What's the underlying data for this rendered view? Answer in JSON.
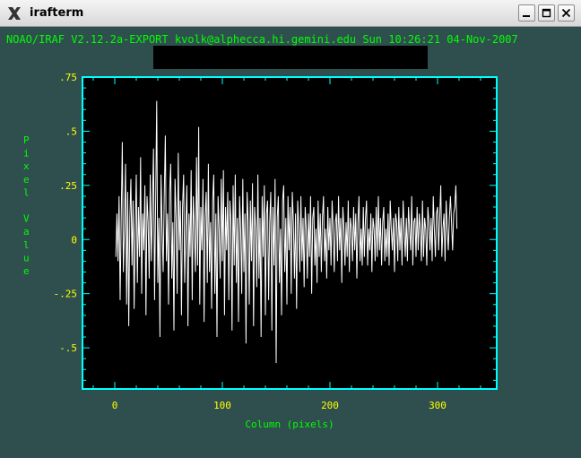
{
  "window": {
    "title": "irafterm",
    "icon": "x-logo-icon",
    "buttons": [
      "minimize",
      "maximize",
      "close"
    ]
  },
  "terminal": {
    "header": "NOAO/IRAF V2.12.2a-EXPORT kvolk@alphecca.hi.gemini.edu Sun 10:26:21 04-Nov-2007"
  },
  "colors": {
    "background": "#2f4f4f",
    "frame": "#00ffff",
    "data": "#ffffff",
    "tick_labels": "#ffff00",
    "axis_labels": "#00ff00"
  },
  "chart_data": {
    "type": "line",
    "xlabel": "Column (pixels)",
    "ylabel": "Pixel Value",
    "xlim": [
      -30,
      355
    ],
    "ylim": [
      -0.69,
      0.75
    ],
    "x_ticks": [
      "0",
      "100",
      "200",
      "300"
    ],
    "y_ticks": [
      ".75",
      ".5",
      ".25",
      "0",
      "-.25",
      "-.5"
    ],
    "x": [
      1,
      2,
      3,
      4,
      5,
      6,
      7,
      8,
      9,
      10,
      11,
      12,
      13,
      14,
      15,
      16,
      17,
      18,
      19,
      20,
      21,
      22,
      23,
      24,
      25,
      26,
      27,
      28,
      29,
      30,
      31,
      32,
      33,
      34,
      35,
      36,
      37,
      38,
      39,
      40,
      41,
      42,
      43,
      44,
      45,
      46,
      47,
      48,
      49,
      50,
      51,
      52,
      53,
      54,
      55,
      56,
      57,
      58,
      59,
      60,
      61,
      62,
      63,
      64,
      65,
      66,
      67,
      68,
      69,
      70,
      71,
      72,
      73,
      74,
      75,
      76,
      77,
      78,
      79,
      80,
      81,
      82,
      83,
      84,
      85,
      86,
      87,
      88,
      89,
      90,
      91,
      92,
      93,
      94,
      95,
      96,
      97,
      98,
      99,
      100,
      101,
      102,
      103,
      104,
      105,
      106,
      107,
      108,
      109,
      110,
      111,
      112,
      113,
      114,
      115,
      116,
      117,
      118,
      119,
      120,
      121,
      122,
      123,
      124,
      125,
      126,
      127,
      128,
      129,
      130,
      131,
      132,
      133,
      134,
      135,
      136,
      137,
      138,
      139,
      140,
      141,
      142,
      143,
      144,
      145,
      146,
      147,
      148,
      149,
      150,
      151,
      152,
      153,
      154,
      155,
      156,
      157,
      158,
      159,
      160,
      161,
      162,
      163,
      164,
      165,
      166,
      167,
      168,
      169,
      170,
      171,
      172,
      173,
      174,
      175,
      176,
      177,
      178,
      179,
      180,
      181,
      182,
      183,
      184,
      185,
      186,
      187,
      188,
      189,
      190,
      191,
      192,
      193,
      194,
      195,
      196,
      197,
      198,
      199,
      200,
      201,
      202,
      203,
      204,
      205,
      206,
      207,
      208,
      209,
      210,
      211,
      212,
      213,
      214,
      215,
      216,
      217,
      218,
      219,
      220,
      221,
      222,
      223,
      224,
      225,
      226,
      227,
      228,
      229,
      230,
      231,
      232,
      233,
      234,
      235,
      236,
      237,
      238,
      239,
      240,
      241,
      242,
      243,
      244,
      245,
      246,
      247,
      248,
      249,
      250,
      251,
      252,
      253,
      254,
      255,
      256,
      257,
      258,
      259,
      260,
      261,
      262,
      263,
      264,
      265,
      266,
      267,
      268,
      269,
      270,
      271,
      272,
      273,
      274,
      275,
      276,
      277,
      278,
      279,
      280,
      281,
      282,
      283,
      284,
      285,
      286,
      287,
      288,
      289,
      290,
      291,
      292,
      293,
      294,
      295,
      296,
      297,
      298,
      299,
      300,
      301,
      302,
      303,
      304,
      305,
      306,
      307,
      308,
      309,
      310,
      311,
      312,
      313,
      314,
      315,
      316,
      317,
      318,
      319,
      320,
      321
    ],
    "y": [
      -0.08,
      0.12,
      -0.1,
      0.2,
      -0.28,
      0.1,
      0.45,
      -0.15,
      0.05,
      0.35,
      -0.3,
      0.22,
      -0.4,
      0.1,
      0.28,
      -0.12,
      0.18,
      -0.32,
      0.05,
      0.3,
      -0.2,
      0.15,
      -0.08,
      0.38,
      -0.25,
      0.12,
      -0.05,
      0.25,
      -0.35,
      0.2,
      0.08,
      -0.18,
      0.3,
      -0.1,
      0.15,
      0.42,
      -0.28,
      0.18,
      0.64,
      -0.2,
      0.1,
      -0.45,
      0.3,
      0.05,
      -0.15,
      0.2,
      0.48,
      -0.1,
      0.12,
      -0.3,
      0.22,
      0.35,
      -0.18,
      0.08,
      -0.42,
      0.28,
      0.1,
      -0.25,
      0.4,
      -0.05,
      0.18,
      -0.35,
      0.15,
      0.3,
      -0.2,
      0.05,
      0.25,
      -0.4,
      0.12,
      -0.08,
      0.32,
      -0.28,
      0.2,
      0.05,
      -0.15,
      0.38,
      -0.12,
      0.52,
      -0.3,
      0.15,
      -0.05,
      0.28,
      -0.38,
      0.1,
      0.22,
      -0.2,
      0.35,
      -0.15,
      0.08,
      -0.32,
      0.18,
      0.3,
      -0.25,
      0.12,
      -0.45,
      0.2,
      0.05,
      -0.18,
      0.28,
      -0.1,
      0.32,
      -0.35,
      0.15,
      -0.05,
      0.22,
      -0.28,
      0.18,
      0.08,
      -0.42,
      0.25,
      -0.12,
      0.3,
      -0.2,
      0.1,
      -0.38,
      0.2,
      0.05,
      -0.25,
      0.28,
      -0.15,
      0.12,
      -0.48,
      0.22,
      0.08,
      -0.3,
      0.18,
      -0.1,
      0.26,
      -0.4,
      0.15,
      0.05,
      -0.22,
      0.3,
      -0.18,
      0.1,
      -0.45,
      0.2,
      -0.08,
      0.25,
      -0.35,
      0.12,
      0.18,
      -0.28,
      0.08,
      0.22,
      -0.42,
      0.15,
      -0.12,
      0.28,
      -0.57,
      0.1,
      0.2,
      -0.2,
      0.05,
      -0.35,
      0.18,
      0.25,
      -0.15,
      0.1,
      -0.3,
      0.2,
      -0.05,
      0.15,
      -0.25,
      0.22,
      0.08,
      -0.18,
      0.12,
      -0.32,
      0.18,
      0.05,
      -0.15,
      0.2,
      -0.1,
      0.1,
      -0.22,
      0.15,
      0.05,
      -0.18,
      0.12,
      -0.08,
      0.2,
      -0.25,
      0.1,
      0.15,
      -0.12,
      0.05,
      -0.2,
      0.18,
      -0.08,
      0.12,
      -0.15,
      0.1,
      0.2,
      -0.1,
      0.05,
      -0.18,
      0.15,
      -0.05,
      0.1,
      -0.12,
      0.18,
      0.05,
      -0.15,
      0.08,
      0.12,
      -0.1,
      0.2,
      -0.05,
      0.1,
      -0.2,
      0.15,
      0.05,
      -0.12,
      0.08,
      -0.08,
      0.18,
      -0.15,
      0.1,
      0.05,
      -0.1,
      0.15,
      -0.05,
      0.12,
      -0.18,
      0.08,
      0.2,
      -0.1,
      0.05,
      -0.12,
      0.15,
      -0.08,
      0.1,
      0.18,
      -0.12,
      0.05,
      -0.05,
      0.12,
      -0.15,
      0.1,
      0.05,
      -0.1,
      0.15,
      -0.08,
      0.2,
      -0.05,
      0.1,
      -0.12,
      0.08,
      0.15,
      -0.1,
      0.05,
      -0.08,
      0.12,
      -0.12,
      0.18,
      0.05,
      -0.05,
      0.1,
      -0.15,
      0.12,
      0.08,
      -0.1,
      0.15,
      -0.05,
      0.1,
      -0.12,
      0.18,
      0.05,
      -0.08,
      0.1,
      -0.1,
      0.15,
      0.05,
      -0.05,
      0.2,
      -0.12,
      0.08,
      0.1,
      -0.08,
      0.15,
      -0.05,
      0.12,
      0.05,
      -0.1,
      0.18,
      -0.08,
      0.1,
      0.05,
      -0.12,
      0.15,
      0.08,
      -0.05,
      0.1,
      -0.1,
      0.2,
      0.05,
      -0.08,
      0.12,
      0.15,
      -0.05,
      0.1,
      0.25,
      -0.08,
      0.05,
      0.12,
      -0.1,
      0.18,
      0.05,
      -0.05,
      0.1,
      0.2,
      0.08,
      -0.05,
      0.12,
      0.15,
      0.25,
      0.05
    ]
  }
}
